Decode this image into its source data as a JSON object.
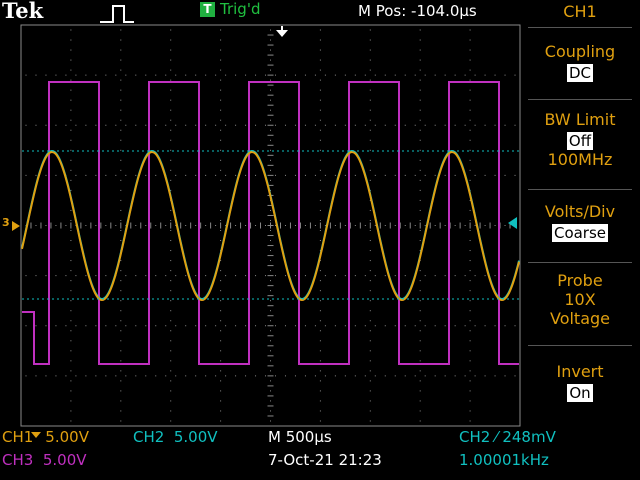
{
  "header": {
    "brand": "Tek",
    "trig_badge": "T",
    "trig_status": "Trig'd",
    "m_pos": "M Pos: -104.0µs",
    "menu_channel": "CH1"
  },
  "menu": {
    "coupling_label": "Coupling",
    "coupling_value": "DC",
    "bw_label": "BW Limit",
    "bw_value": "Off",
    "bw_freq": "100MHz",
    "volts_label": "Volts/Div",
    "volts_value": "Coarse",
    "probe_label": "Probe",
    "probe_atten": "10X",
    "probe_type": "Voltage",
    "invert_label": "Invert",
    "invert_value": "On"
  },
  "footer": {
    "ch1_scale": "CH1",
    "ch1_value": "5.00V",
    "ch2_label": "CH2",
    "ch2_value": "5.00V",
    "timebase": "M 500µs",
    "trigger_info": "CH2 ⁄ 248mV",
    "ch3_label": "CH3",
    "ch3_value": "5.00V",
    "datetime": "7-Oct-21 21:23",
    "frequency": "1.00001kHz"
  },
  "markers": {
    "ch3_marker": "3",
    "trigger_pos": "▼"
  },
  "colors": {
    "ch1": "#e0a010",
    "ch2": "#10c0c0",
    "ch3": "#c030c0",
    "grid": "#8a8a8a"
  }
}
